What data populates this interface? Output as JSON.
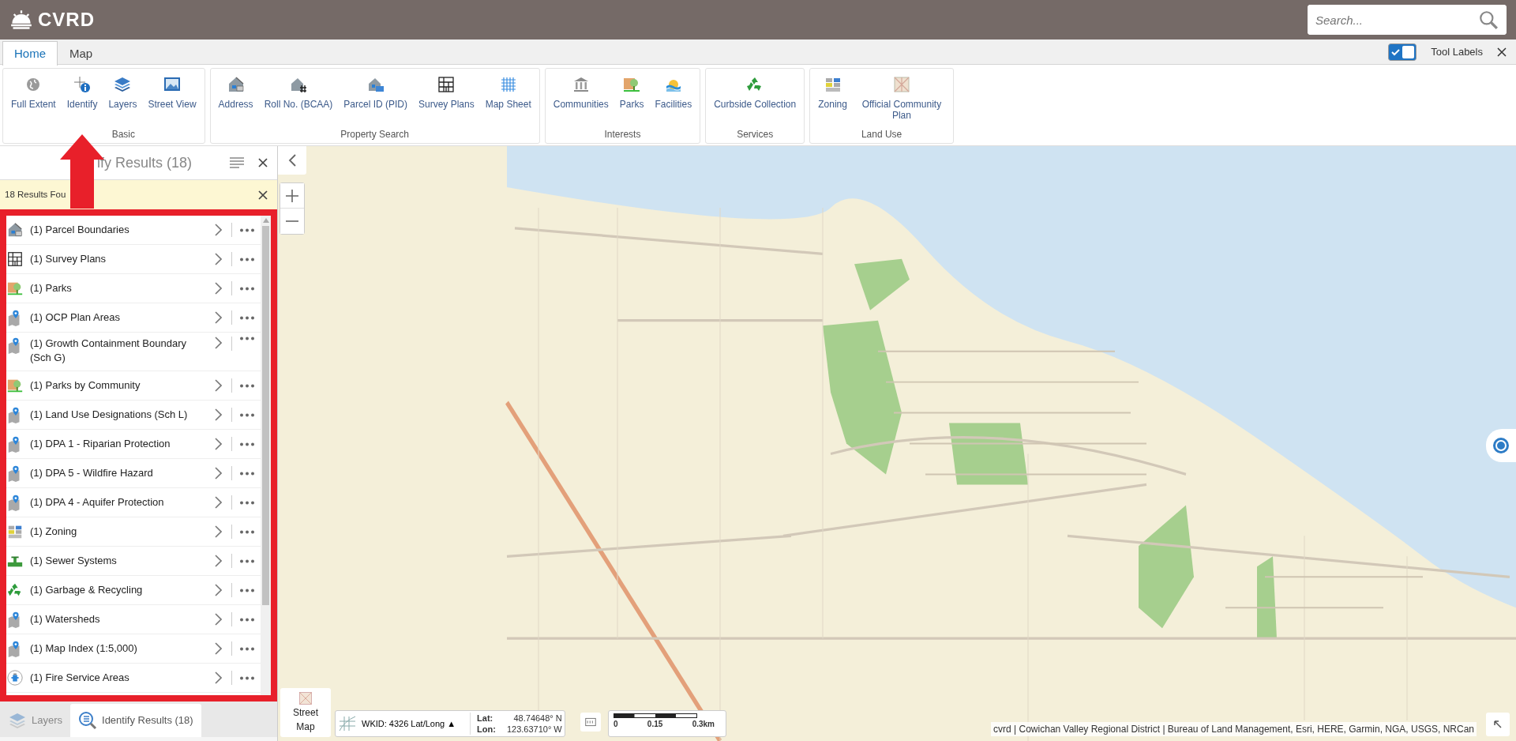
{
  "header": {
    "logo": "CVRD",
    "search": {
      "placeholder": "Search..."
    }
  },
  "tabs": [
    {
      "label": "Home",
      "selected": true
    },
    {
      "label": "Map",
      "selected": false
    }
  ],
  "tool_labels": {
    "label": "Tool Labels",
    "on": true
  },
  "ribbon_groups": [
    {
      "label": "Basic",
      "tools": [
        "Full Extent",
        "Identify",
        "Layers",
        "Street View"
      ]
    },
    {
      "label": "Property Search",
      "tools": [
        "Address",
        "Roll No. (BCAA)",
        "Parcel ID (PID)",
        "Survey Plans",
        "Map Sheet"
      ]
    },
    {
      "label": "Interests",
      "tools": [
        "Communities",
        "Parks",
        "Facilities"
      ]
    },
    {
      "label": "Services",
      "tools": [
        "Curbside Collection"
      ]
    },
    {
      "label": "Land Use",
      "tools": [
        "Zoning",
        "Official Community Plan"
      ]
    }
  ],
  "panel": {
    "title": "ify Results (18)",
    "notice": "18 Results Fou",
    "results": [
      "(1) Parcel Boundaries",
      "(1) Survey Plans",
      "(1) Parks",
      "(1) OCP Plan Areas",
      "(1) Growth Containment Boundary (Sch G)",
      "(1) Parks by Community",
      "(1) Land Use Designations (Sch L)",
      "(1) DPA 1 - Riparian Protection",
      "(1) DPA 5 - Wildfire Hazard",
      "(1) DPA 4 - Aquifer Protection",
      "(1) Zoning",
      "(1) Sewer Systems",
      "(1) Garbage & Recycling",
      "(1) Watersheds",
      "(1) Map Index (1:5,000)",
      "(1) Fire Service Areas"
    ],
    "bottom_tabs": [
      {
        "label": "Layers",
        "selected": false
      },
      {
        "label": "Identify Results (18)",
        "selected": true
      }
    ]
  },
  "map": {
    "basemap_button": "Street Map",
    "wkid": "WKID: 4326 Lat/Long",
    "wkid_caret": "▲",
    "lat_label": "Lat:",
    "lat": "48.74648° N",
    "lon_label": "Lon:",
    "lon": "123.63710° W",
    "scale_labels": [
      "0",
      "0.15",
      "0.3km"
    ],
    "attribution": "cvrd | Cowichan Valley Regional District | Bureau of Land Management, Esri, HERE, Garmin, NGA, USGS, NRCan"
  }
}
